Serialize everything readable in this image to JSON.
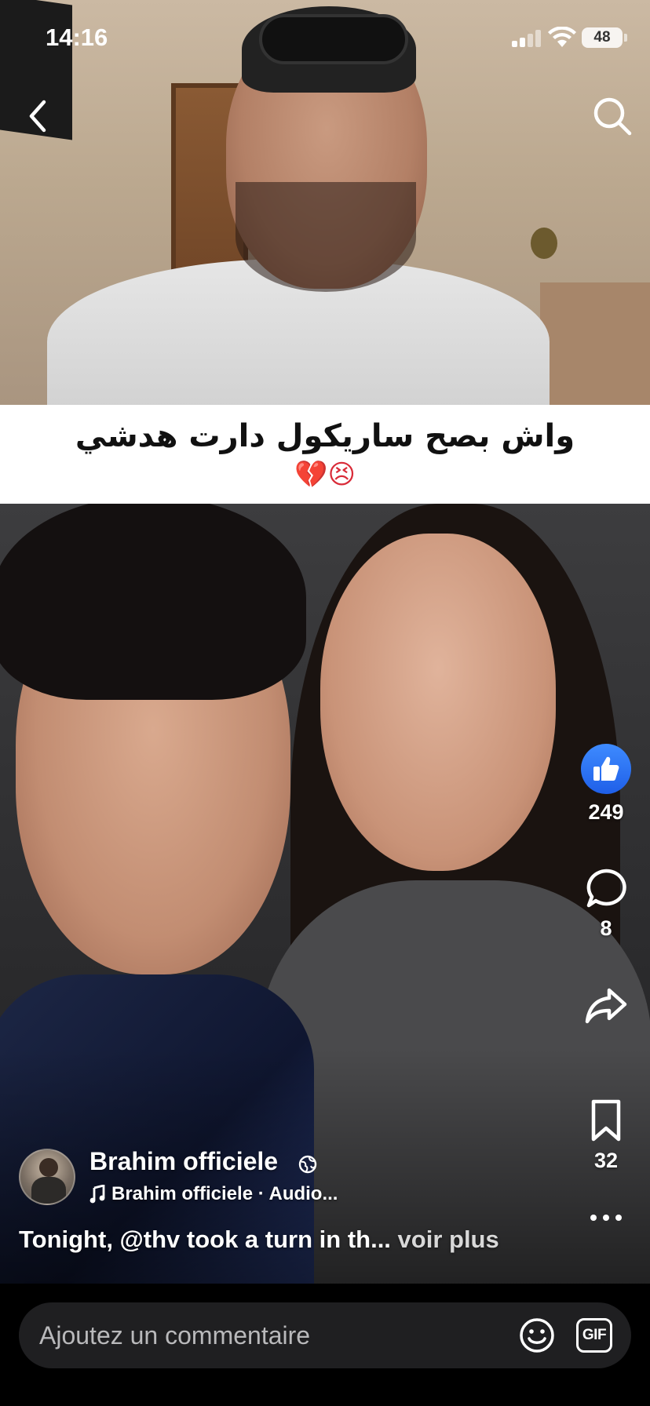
{
  "status_bar": {
    "time": "14:16",
    "battery": "48"
  },
  "caption_overlay": {
    "text": "واش بصح ساريكول دارت هدشي",
    "emojis": "💔😣"
  },
  "actions": {
    "like_count": "249",
    "comment_count": "8",
    "save_count": "32"
  },
  "author": {
    "name": "Brahim officiele",
    "audio": "Brahim officiele · Audio..."
  },
  "post": {
    "caption": "Tonight, @thv took a turn in th...",
    "more_label": "voir plus"
  },
  "comment_bar": {
    "placeholder": "Ajoutez un commentaire",
    "gif_label": "GIF"
  },
  "icons": {
    "back": "chevron-left-icon",
    "search": "search-icon",
    "like": "thumbs-up-icon",
    "comment": "comment-bubble-icon",
    "share": "share-arrow-icon",
    "save": "bookmark-icon",
    "more": "more-dots-icon",
    "audio": "music-note-icon",
    "visibility": "globe-icon",
    "emoji": "smiley-icon",
    "gif": "gif-icon"
  },
  "colors": {
    "like_blue": "#1f5fe8",
    "caption_band": "#ffffff",
    "comment_bg": "#1f1f21"
  }
}
